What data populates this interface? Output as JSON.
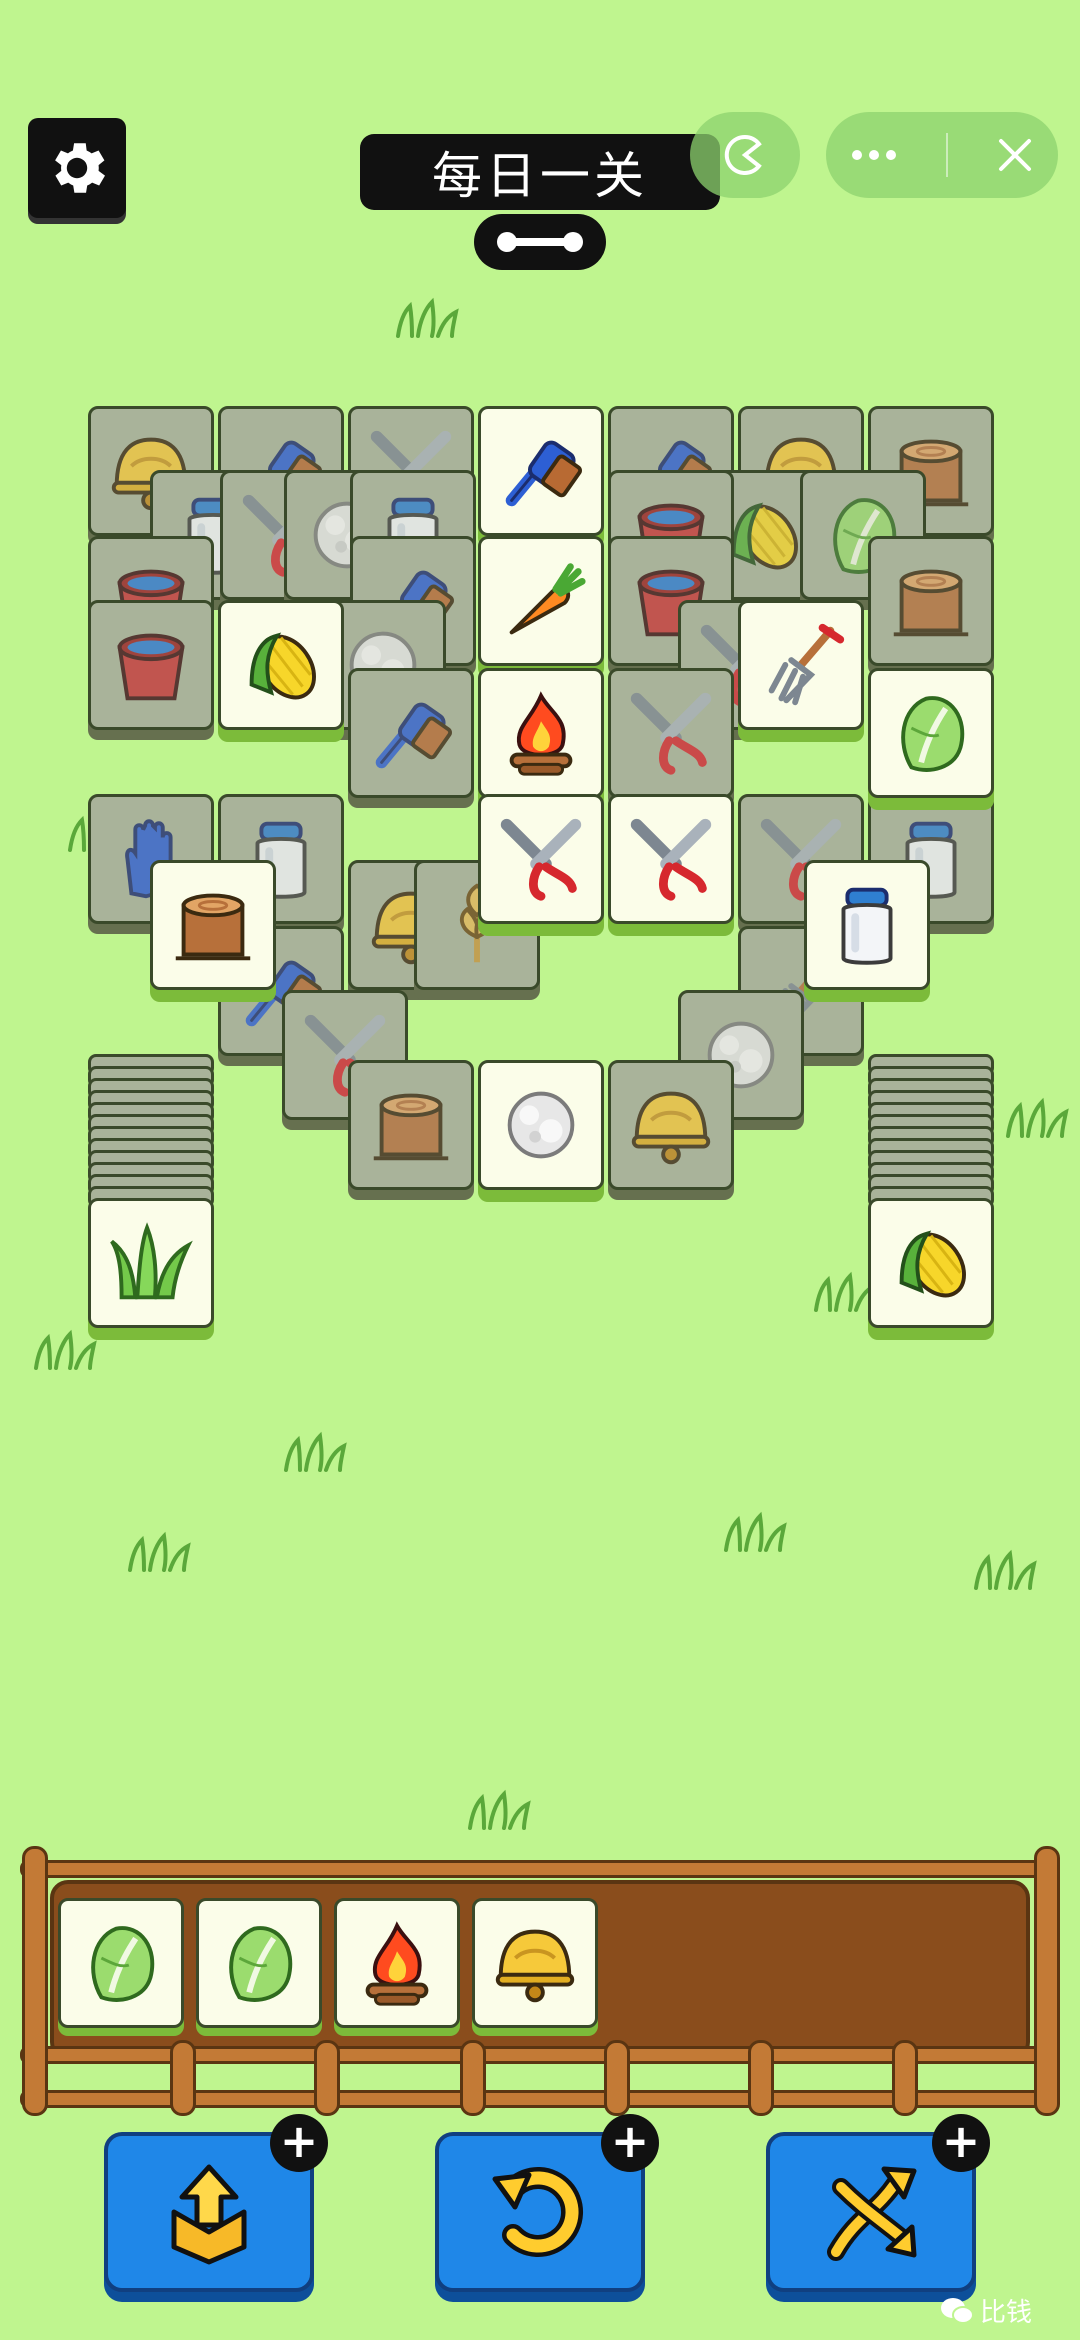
{
  "header": {
    "title": "每日一关",
    "settings_icon": "gear-icon",
    "progress_icon": "bone-icon"
  },
  "capsule": {
    "game_icon": "pacman-icon",
    "more_icon": "more-dots-icon",
    "close_icon": "close-icon"
  },
  "board": {
    "tiles": [
      {
        "icon": "bell",
        "state": "dim"
      },
      {
        "icon": "brush",
        "state": "dim"
      },
      {
        "icon": "shears",
        "state": "dim"
      },
      {
        "icon": "brush",
        "state": "active"
      },
      {
        "icon": "brush",
        "state": "dim"
      },
      {
        "icon": "bell",
        "state": "dim"
      },
      {
        "icon": "stump",
        "state": "dim"
      },
      {
        "icon": "milk",
        "state": "dim"
      },
      {
        "icon": "shears",
        "state": "dim"
      },
      {
        "icon": "cotton",
        "state": "dim"
      },
      {
        "icon": "milk",
        "state": "dim"
      },
      {
        "icon": "bucket",
        "state": "dim"
      },
      {
        "icon": "corn",
        "state": "dim"
      },
      {
        "icon": "bucket",
        "state": "dim"
      },
      {
        "icon": "cabbage",
        "state": "dim"
      },
      {
        "icon": "bucket",
        "state": "dim"
      },
      {
        "icon": "brush",
        "state": "dim"
      },
      {
        "icon": "carrot",
        "state": "active"
      },
      {
        "icon": "bucket",
        "state": "dim"
      },
      {
        "icon": "stump",
        "state": "dim"
      },
      {
        "icon": "corn",
        "state": "active"
      },
      {
        "icon": "cotton",
        "state": "dim"
      },
      {
        "icon": "shears",
        "state": "dim"
      },
      {
        "icon": "fork",
        "state": "active"
      },
      {
        "icon": "brush",
        "state": "dim"
      },
      {
        "icon": "fire",
        "state": "active"
      },
      {
        "icon": "shears",
        "state": "dim"
      },
      {
        "icon": "cabbage",
        "state": "active"
      },
      {
        "icon": "glove",
        "state": "dim"
      },
      {
        "icon": "milk",
        "state": "dim"
      },
      {
        "icon": "shears",
        "state": "active"
      },
      {
        "icon": "shears",
        "state": "active"
      },
      {
        "icon": "shears",
        "state": "dim"
      },
      {
        "icon": "milk",
        "state": "dim"
      },
      {
        "icon": "stump",
        "state": "active"
      },
      {
        "icon": "bell",
        "state": "dim"
      },
      {
        "icon": "wheat",
        "state": "dim"
      },
      {
        "icon": "milk",
        "state": "active"
      },
      {
        "icon": "brush",
        "state": "dim"
      },
      {
        "icon": "fork",
        "state": "dim"
      },
      {
        "icon": "shears",
        "state": "dim"
      },
      {
        "icon": "cotton",
        "state": "dim"
      },
      {
        "icon": "stump",
        "state": "dim"
      },
      {
        "icon": "cotton",
        "state": "active"
      },
      {
        "icon": "bell",
        "state": "dim"
      }
    ],
    "left_stack": {
      "count": 12,
      "top_icon": "grass"
    },
    "right_stack": {
      "count": 12,
      "top_icon": "corn"
    }
  },
  "tray": {
    "slots": [
      "cabbage",
      "cabbage",
      "fire",
      "bell"
    ],
    "capacity": 7
  },
  "tools": [
    {
      "name": "move-out",
      "icon": "box-arrow-out-icon",
      "plus": "+"
    },
    {
      "name": "undo",
      "icon": "undo-icon",
      "plus": "+"
    },
    {
      "name": "shuffle",
      "icon": "shuffle-icon",
      "plus": "+"
    }
  ],
  "watermark": {
    "text": "比钱",
    "icon": "wechat-icon"
  },
  "colors": {
    "background": "#bff58f",
    "tile_face": "#fbfde9",
    "tile_dim": "#a9b39a",
    "button": "#1f87e8",
    "tray": "#8a4d1c"
  }
}
